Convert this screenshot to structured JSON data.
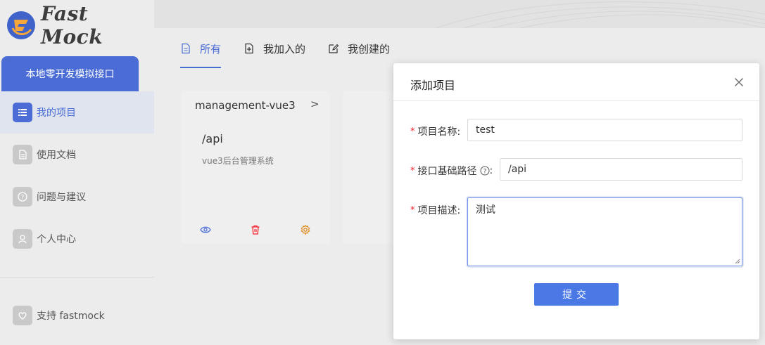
{
  "app": {
    "logo_text": "Fast Mock",
    "tagline": "本地零开发模拟接口"
  },
  "sidebar": {
    "items": [
      {
        "label": "我的项目",
        "icon": "list-icon",
        "active": true
      },
      {
        "label": "使用文档",
        "icon": "document-icon",
        "active": false
      },
      {
        "label": "问题与建议",
        "icon": "question-icon",
        "active": false
      },
      {
        "label": "个人中心",
        "icon": "user-icon",
        "active": false
      }
    ],
    "support_label": "支持 fastmock"
  },
  "tabs": [
    {
      "label": "所有",
      "icon": "file-icon",
      "active": true
    },
    {
      "label": "我加入的",
      "icon": "file-add-icon",
      "active": false
    },
    {
      "label": "我创建的",
      "icon": "edit-icon",
      "active": false
    }
  ],
  "project_card": {
    "name": "management-vue3",
    "arrow": ">",
    "base_path": "/api",
    "description": "vue3后台管理系统",
    "actions": [
      "eye-icon",
      "trash-icon",
      "gear-icon"
    ]
  },
  "modal": {
    "title": "添加项目",
    "fields": {
      "name_label": "项目名称:",
      "name_value": "test",
      "path_label": "接口基础路径",
      "path_colon": ":",
      "path_value": "/api",
      "desc_label": "项目描述:",
      "desc_value": "测试"
    },
    "required_mark": "*",
    "submit_label": "提交"
  },
  "colors": {
    "accent": "#4a6cd4",
    "button": "#4a79e6",
    "danger": "#f5222d",
    "warning": "#e08a1e"
  }
}
